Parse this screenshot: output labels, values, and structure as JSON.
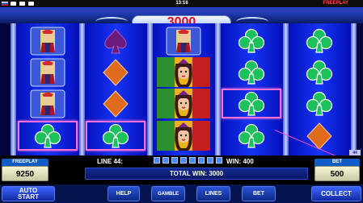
{
  "topbar": {
    "time": "13:16",
    "freeplay": "FREEPLAY"
  },
  "header": {
    "win_amount": "3000"
  },
  "reels": {
    "columns": [
      [
        "queen",
        "queen",
        "club"
      ],
      [
        "spade",
        "diamond",
        "club"
      ],
      [
        "queen",
        "jester",
        "jester"
      ],
      [
        "club",
        "club",
        "club"
      ],
      [
        "club",
        "club",
        "diamond"
      ]
    ]
  },
  "info": {
    "line_label": "LINE 44:",
    "win_label": "WIN: 400",
    "total_win": "TOTAL WIN: 3000",
    "freeplay_label": "FREEPLAY",
    "freeplay_value": "9250",
    "bet_label": "BET",
    "bet_value": "500",
    "side_badge": "44"
  },
  "buttons": {
    "auto_start_line1": "AUTO",
    "auto_start_line2": "START",
    "help": "HELP",
    "gamble": "GAMBLE",
    "lines": "LINES",
    "bet": "BET",
    "collect": "COLLECT"
  },
  "colors": {
    "win_red": "#d9101b",
    "club_green": "#1bc15b",
    "diamond_orange": "#e06b1a",
    "spade_purple": "#6b1b7a",
    "highlight_pink": "#ff6fd8"
  }
}
